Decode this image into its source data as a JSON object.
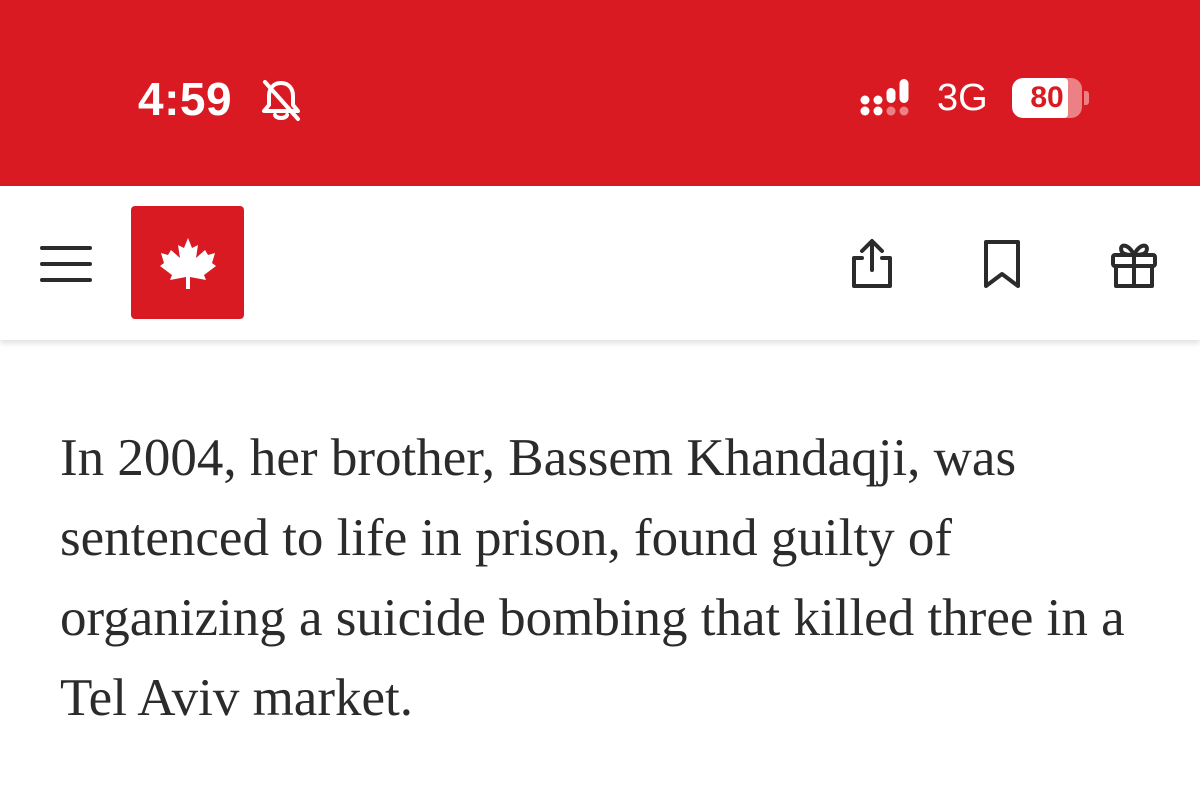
{
  "status_bar": {
    "time": "4:59",
    "network": "3G",
    "battery_level": "80",
    "battery_fraction": 0.8,
    "background_color": "#da1a22",
    "icons": [
      "bell-muted-icon",
      "signal-icon",
      "battery-icon"
    ]
  },
  "header": {
    "logo_color": "#da1a22",
    "icons": [
      "menu-icon",
      "maple-leaf-icon",
      "share-icon",
      "bookmark-icon",
      "gift-icon"
    ]
  },
  "article": {
    "paragraph": "In 2004, her brother, Bassem Khandaqji, was sentenced to life in prison, found guilty of organizing a suicide bombing that killed three in a Tel Aviv market."
  }
}
